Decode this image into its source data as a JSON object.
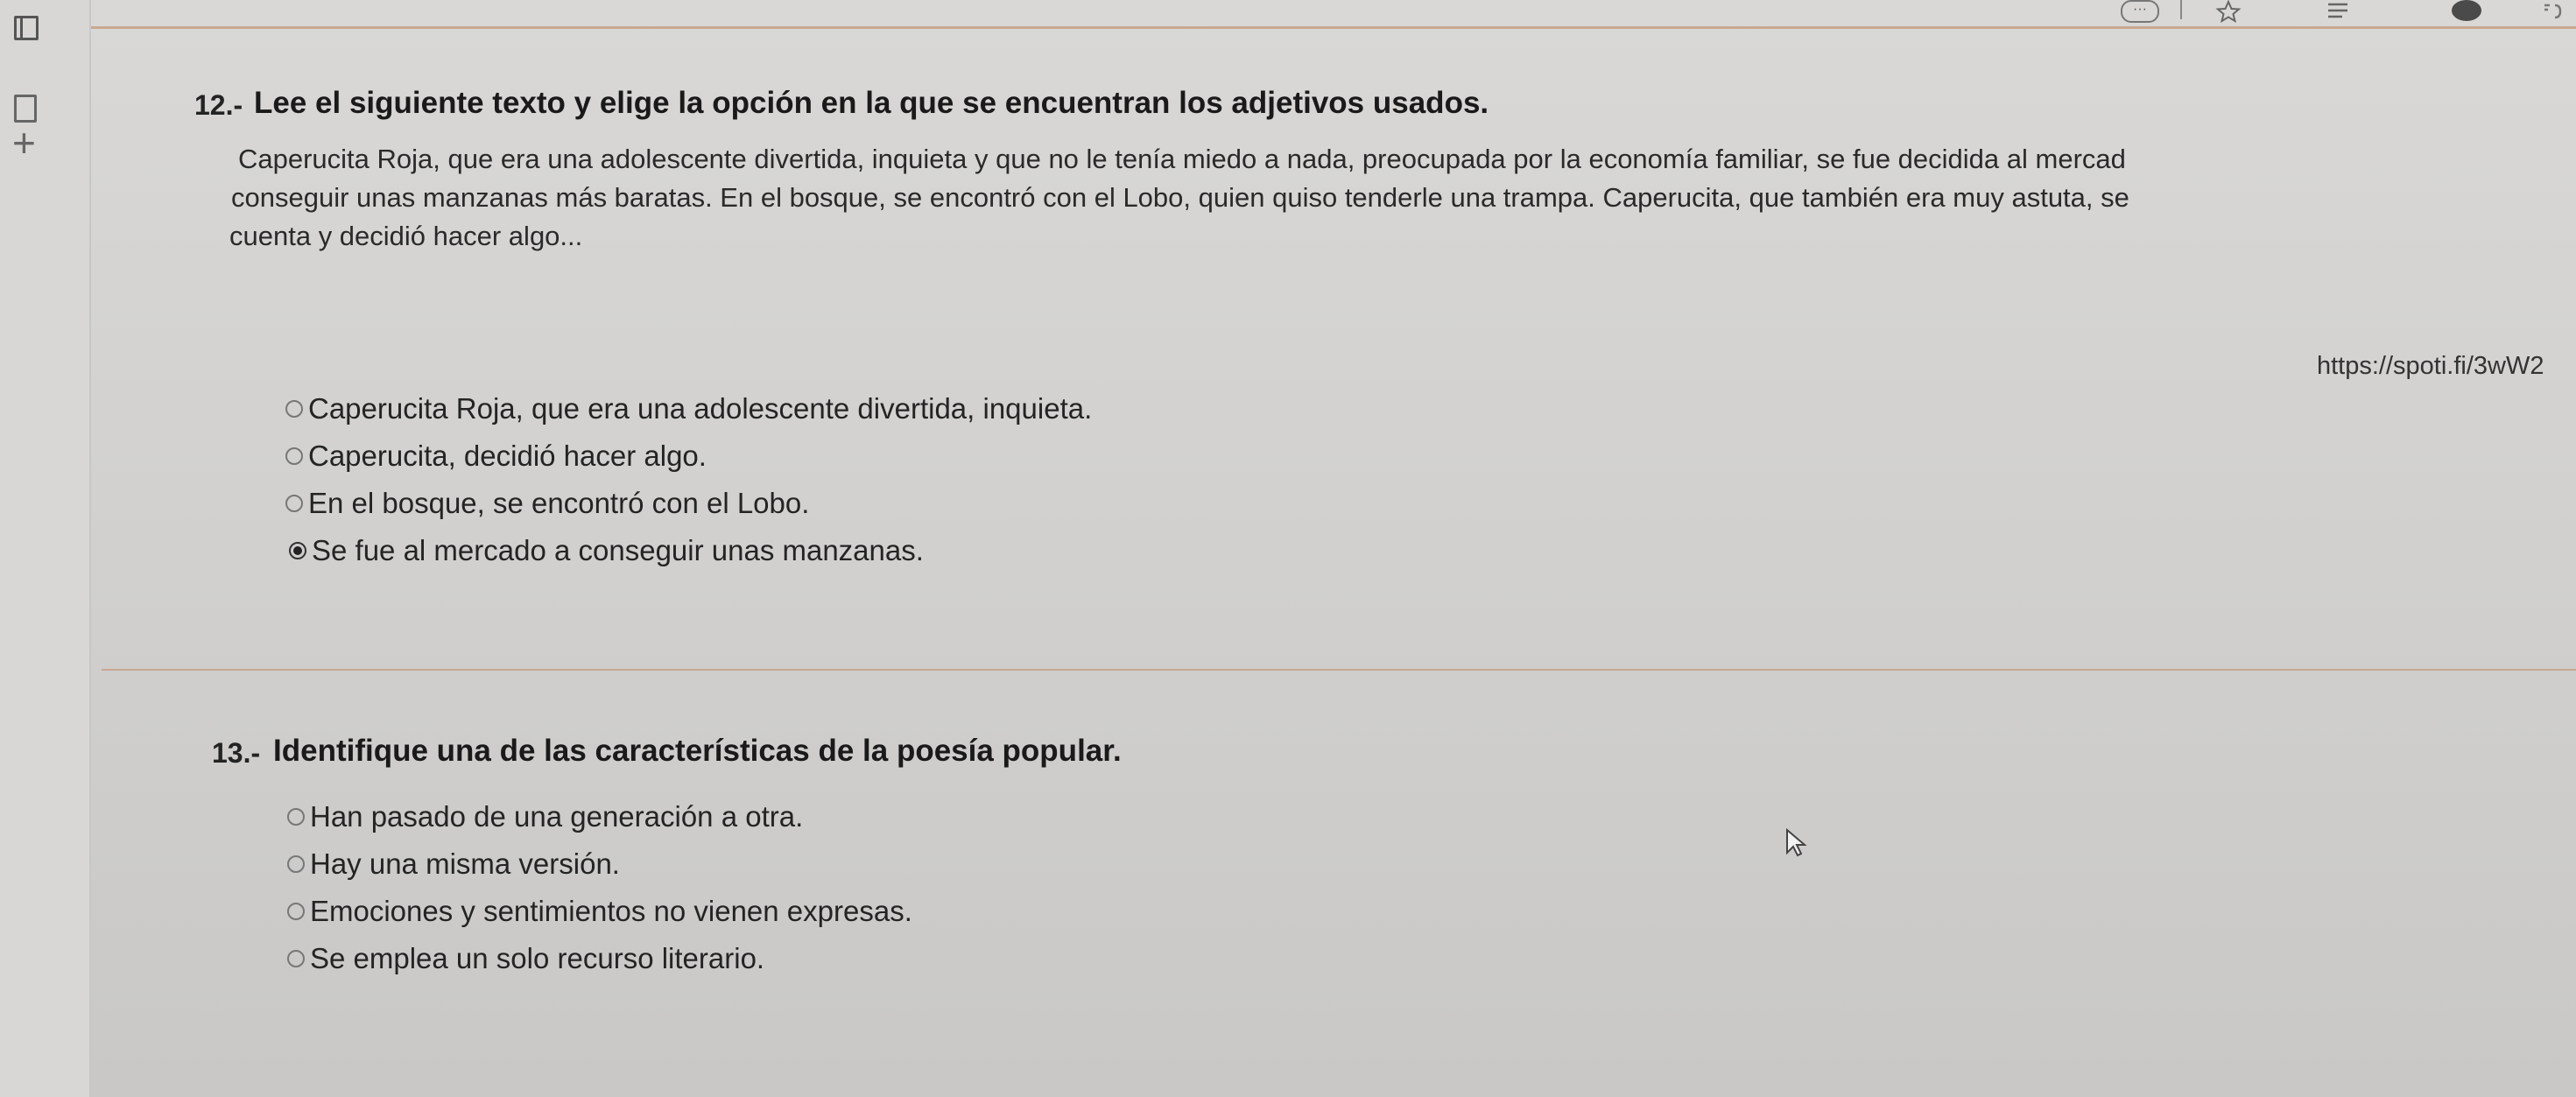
{
  "browser": {
    "toolbar": {
      "more_icon": "more-icon",
      "star_icon": "star-icon",
      "list_icon": "list-icon",
      "avatar_icon": "avatar-icon",
      "extensions_icon": "extensions-icon"
    }
  },
  "sidebar": {
    "icons": [
      "tab-icon",
      "document-icon",
      "plus-icon"
    ],
    "plus_glyph": "+"
  },
  "question12": {
    "number": "12.-",
    "prompt": "Lee el siguiente texto y elige la opción en la que se encuentran los adjetivos usados.",
    "passage_lines": [
      "Caperucita Roja, que era una adolescente divertida, inquieta y que no le tenía miedo a nada, preocupada por la economía familiar, se fue decidida al mercad",
      "conseguir unas manzanas más baratas. En el bosque, se encontró con el Lobo, quien quiso tenderle una trampa. Caperucita, que también era muy astuta, se",
      "cuenta y decidió hacer algo..."
    ],
    "link": "https://spoti.fi/3wW2",
    "options": [
      {
        "label": "Caperucita Roja, que era una adolescente divertida, inquieta.",
        "checked": false
      },
      {
        "label": "Caperucita, decidió hacer algo.",
        "checked": false
      },
      {
        "label": "En el bosque, se encontró con el Lobo.",
        "checked": false
      },
      {
        "label": "Se fue al mercado a conseguir unas manzanas.",
        "checked": true
      }
    ]
  },
  "question13": {
    "number": "13.-",
    "prompt": "Identifique una de las características de la poesía popular.",
    "options": [
      {
        "label": "Han pasado de una generación a otra.",
        "checked": false
      },
      {
        "label": "Hay una misma versión.",
        "checked": false
      },
      {
        "label": "Emociones y sentimientos no vienen expresas.",
        "checked": false
      },
      {
        "label": "Se emplea un solo recurso literario.",
        "checked": false
      }
    ]
  },
  "colors": {
    "background": "#d4d3d1",
    "divider": "#c7a893",
    "text": "#1e1e1e"
  }
}
